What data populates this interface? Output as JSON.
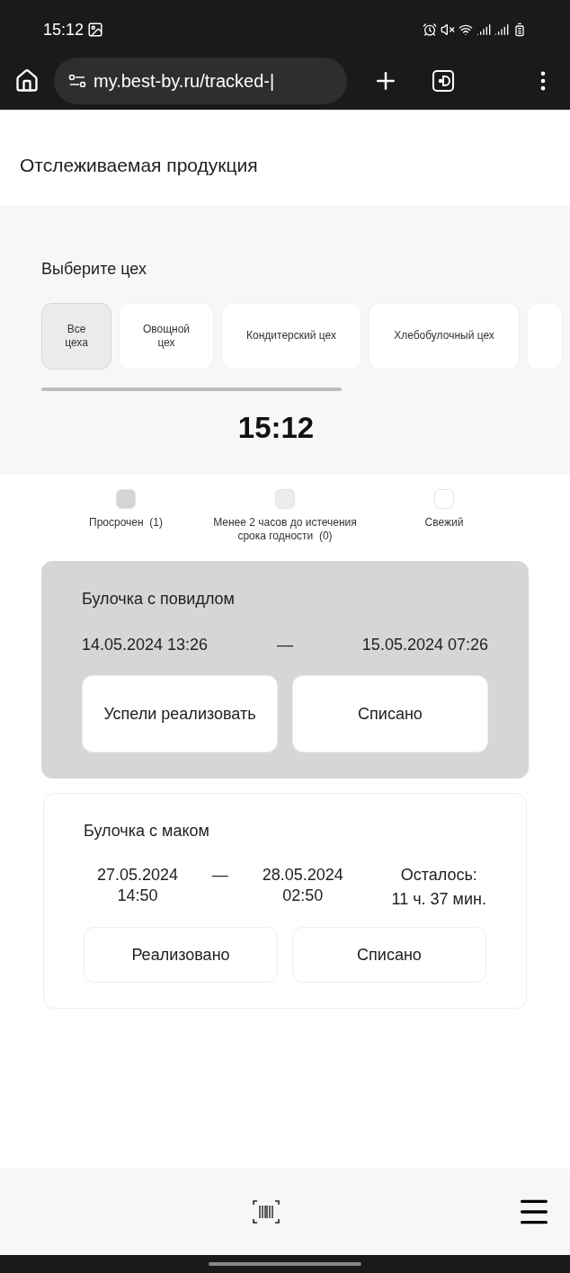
{
  "status_bar": {
    "time": "15:12"
  },
  "browser": {
    "url": "my.best-by.ru/tracked-|"
  },
  "page_title": "Отслеживаемая продукция",
  "workshops": {
    "label": "Выберите цех",
    "items": [
      {
        "label": "Все цеха",
        "selected": true
      },
      {
        "label": "Овощной цех",
        "selected": false
      },
      {
        "label": "Кондитерский цех",
        "selected": false
      },
      {
        "label": "Хлебобулочный цех",
        "selected": false
      }
    ]
  },
  "clock": "15:12",
  "legend": [
    {
      "label": "Просрочен  (1)",
      "color": "#d4d4d4"
    },
    {
      "label": "Менее 2 часов до истечения срока годности  (0)",
      "color": "#ececec"
    },
    {
      "label": "Свежий",
      "color": "#ffffff"
    }
  ],
  "products": [
    {
      "kind": "expired",
      "name": "Булочка с повидлом",
      "start": "14.05.2024 13:26",
      "dash": "—",
      "end": "15.05.2024 07:26",
      "buttons": [
        "Успели реализовать",
        "Списано"
      ]
    },
    {
      "kind": "fresh",
      "name": "Булочка с маком",
      "start": "27.05.2024 14:50",
      "dash": "—",
      "end": "28.05.2024 02:50",
      "remaining_label": "Осталось:",
      "remaining": "11 ч. 37 мин.",
      "buttons": [
        "Реализовано",
        "Списано"
      ]
    }
  ]
}
